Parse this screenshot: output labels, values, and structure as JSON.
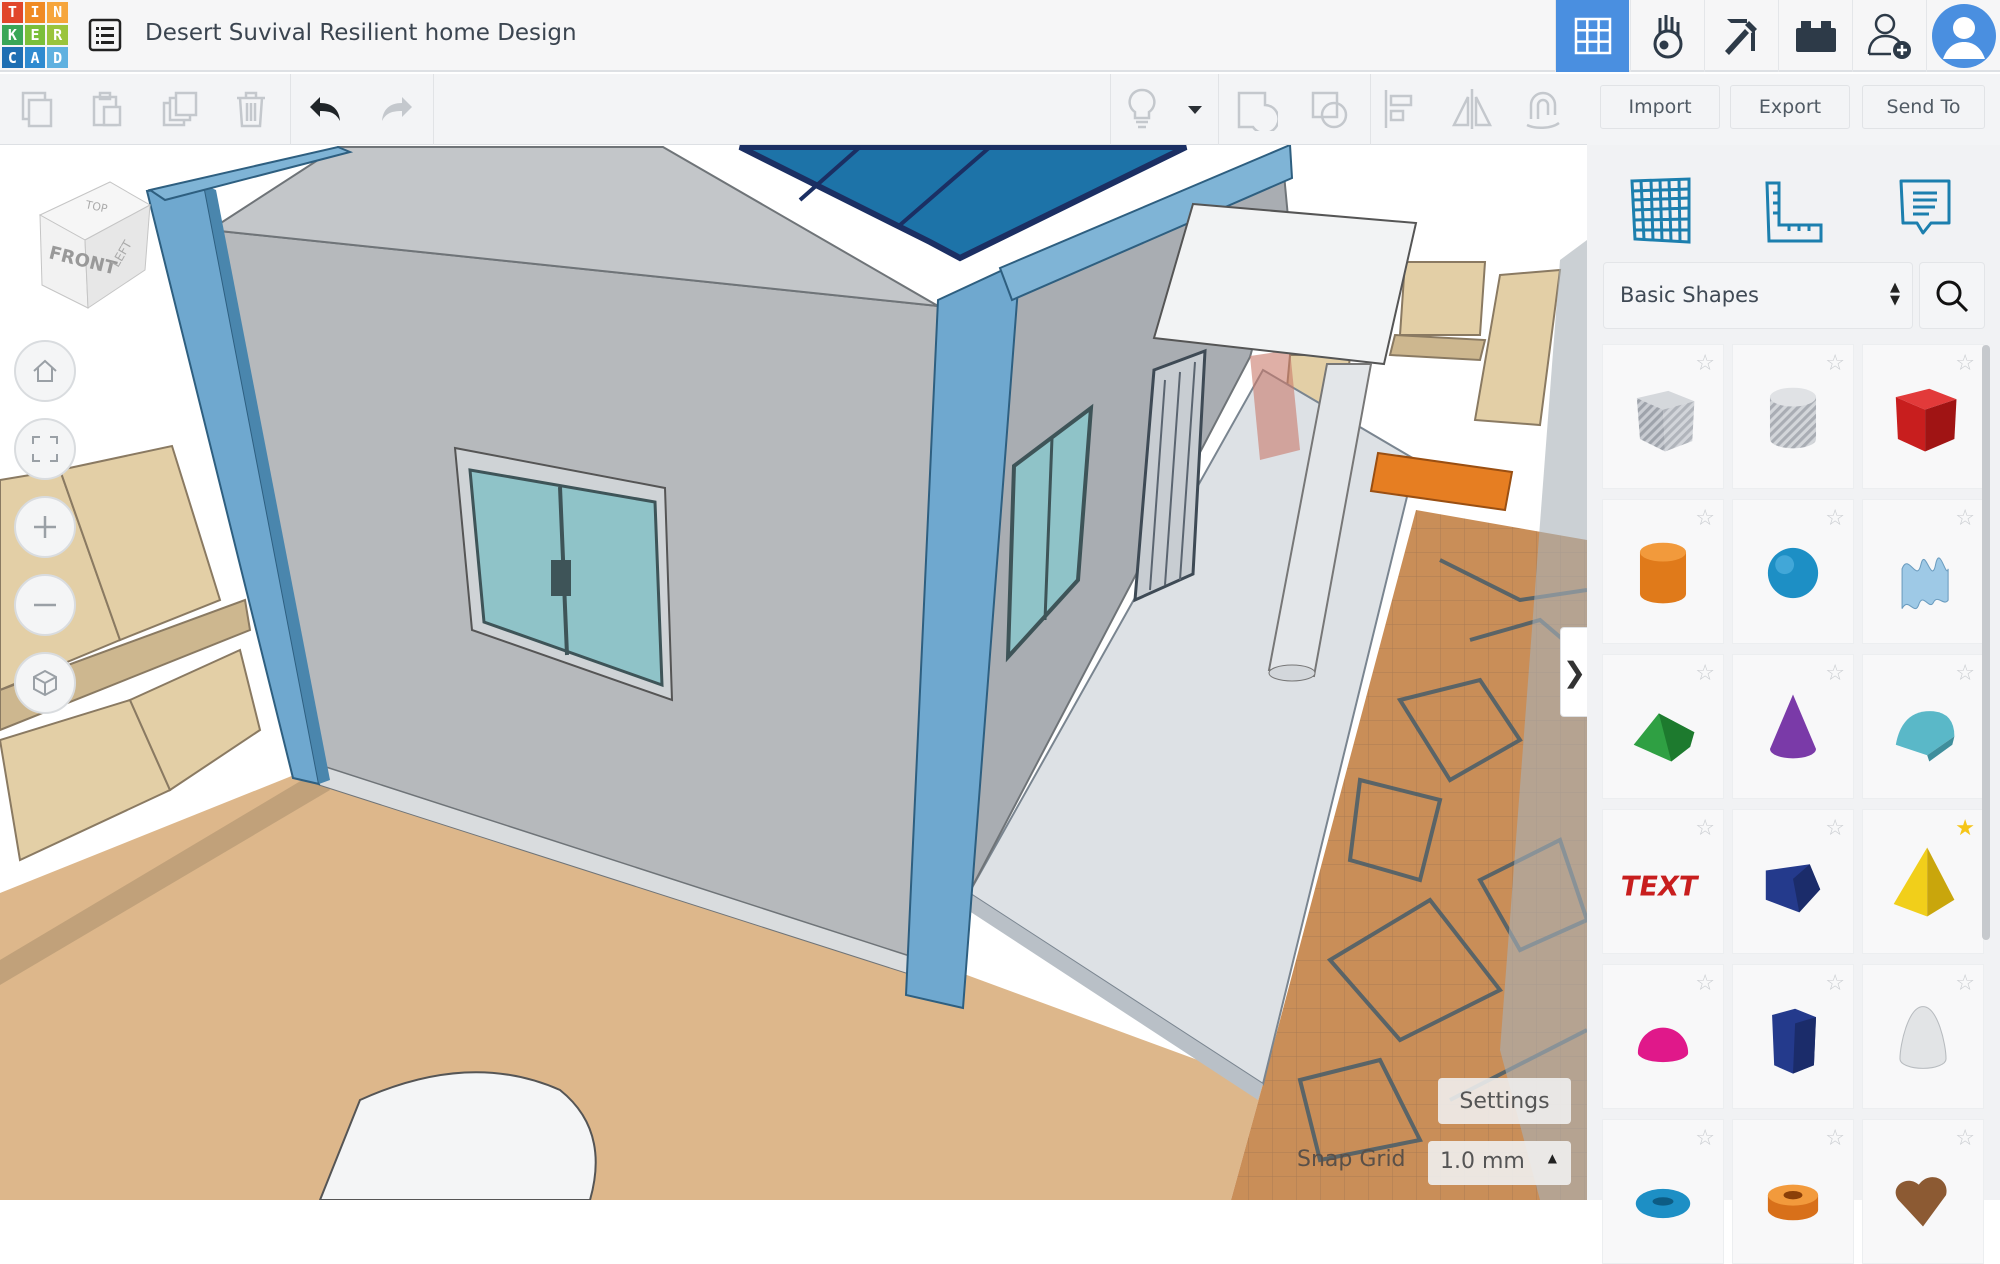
{
  "app": {
    "logo_letters": [
      "T",
      "I",
      "N",
      "K",
      "E",
      "R",
      "C",
      "A",
      "D"
    ],
    "logo_colors": [
      "#e1462a",
      "#f08a24",
      "#f6a53c",
      "#3aa657",
      "#7bbf3a",
      "#9ac43c",
      "#1e6fb3",
      "#2f8bd0",
      "#5fb1e0"
    ],
    "title": "Desert Suvival Resilient home Design"
  },
  "nav": {
    "icons": [
      "3d-design-grid-icon",
      "codeblocks-icon",
      "minecraft-pickaxe-icon",
      "bricks-icon",
      "invite-user-icon",
      "user-avatar-icon"
    ],
    "accent": "#4a8fe0"
  },
  "toolbar": {
    "left_icons": [
      "copy-icon",
      "paste-icon",
      "duplicate-icon",
      "delete-icon",
      "undo-icon",
      "redo-icon"
    ],
    "right_icons": [
      "light-bulb-icon",
      "dropdown-caret-icon",
      "group-icon",
      "ungroup-icon",
      "align-icon",
      "mirror-icon",
      "cruise-icon"
    ],
    "import_label": "Import",
    "export_label": "Export",
    "send_to_label": "Send To"
  },
  "viewcube": {
    "top": "TOP",
    "front": "FRONT",
    "left": "LEFT"
  },
  "panel": {
    "icons": [
      "workplane-icon",
      "ruler-icon",
      "notes-icon"
    ],
    "category": "Basic Shapes",
    "shapes": [
      {
        "icon": "box-hole-icon",
        "starred": false
      },
      {
        "icon": "cylinder-hole-icon",
        "starred": false
      },
      {
        "icon": "box-icon",
        "starred": false
      },
      {
        "icon": "cylinder-icon",
        "starred": false
      },
      {
        "icon": "sphere-icon",
        "starred": false
      },
      {
        "icon": "scribble-icon",
        "starred": false
      },
      {
        "icon": "roof-icon",
        "starred": false
      },
      {
        "icon": "cone-icon",
        "starred": false
      },
      {
        "icon": "round-roof-icon",
        "starred": false
      },
      {
        "icon": "text-icon",
        "starred": false
      },
      {
        "icon": "wedge-icon",
        "starred": false
      },
      {
        "icon": "pyramid-icon",
        "starred": true
      },
      {
        "icon": "half-sphere-icon",
        "starred": false
      },
      {
        "icon": "polygon-icon",
        "starred": false
      },
      {
        "icon": "paraboloid-icon",
        "starred": false
      },
      {
        "icon": "torus-icon",
        "starred": false
      },
      {
        "icon": "tube-icon",
        "starred": false
      },
      {
        "icon": "heart-icon",
        "starred": false
      }
    ]
  },
  "canvas": {
    "settings_label": "Settings",
    "snap_grid_label": "Snap Grid",
    "snap_grid_value": "1.0 mm",
    "collapse_label": "❯"
  }
}
